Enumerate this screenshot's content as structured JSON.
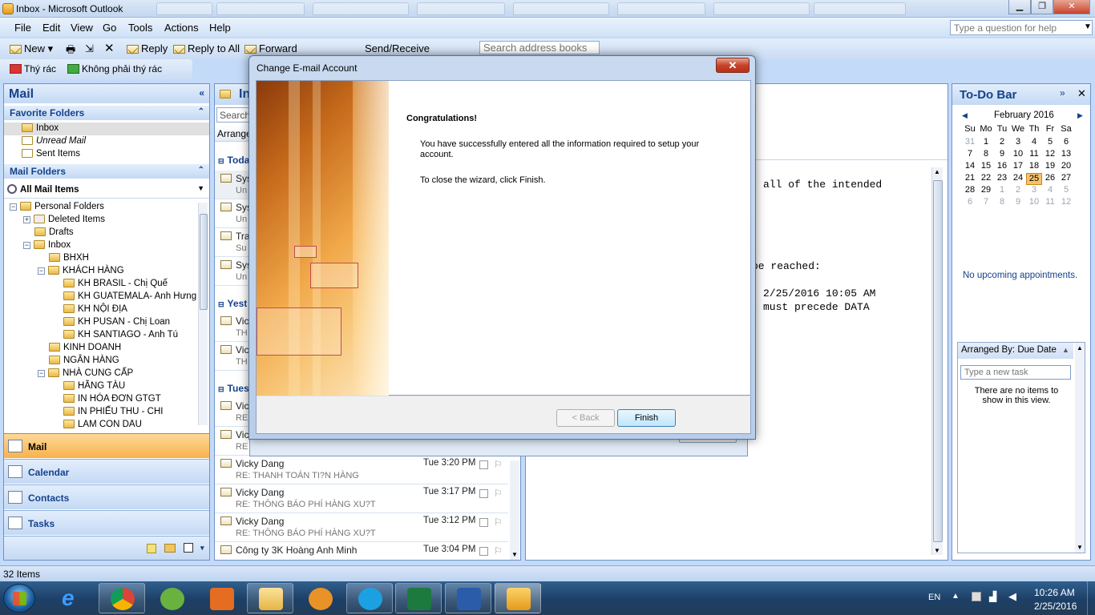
{
  "window": {
    "title": "Inbox - Microsoft Outlook",
    "min": "▁",
    "max": "❐",
    "close": "✕"
  },
  "menu": {
    "items": [
      "File",
      "Edit",
      "View",
      "Go",
      "Tools",
      "Actions",
      "Help"
    ],
    "help_placeholder": "Type a question for help"
  },
  "toolbar": {
    "new": "New",
    "reply": "Reply",
    "reply_all": "Reply to All",
    "forward": "Forward",
    "send_receive": "Send/Receive",
    "search_address": "Search address books",
    "junk": "Thý rác",
    "not_junk": "Không phải thý rác"
  },
  "nav": {
    "title": "Mail",
    "favorites_header": "Favorite Folders",
    "favorites": [
      "Inbox",
      "Unread Mail",
      "Sent Items"
    ],
    "mail_folders_header": "Mail Folders",
    "all_mail_items": "All Mail Items",
    "tree": {
      "personal": "Personal Folders",
      "deleted": "Deleted Items",
      "drafts": "Drafts",
      "inbox": "Inbox",
      "bhxh": "BHXH",
      "khach_hang": "KHÁCH HÀNG",
      "kh1": "KH BRASIL - Chị Quế",
      "kh2": "KH GUATEMALA- Anh Hưng",
      "kh3": "KH NỘI ĐỊA",
      "kh4": "KH PUSAN - Chị Loan",
      "kh5": "KH SANTIAGO - Anh Tú",
      "kinh_doanh": "KINH DOANH",
      "ngan_hang": "NGÂN HÀNG",
      "nha_cung_cap": "NHÀ CUNG CẤP",
      "ncc1": "HÃNG TÀU",
      "ncc2": "IN HÓA ĐƠN GTGT",
      "ncc3": "IN PHIẾU THU - CHI",
      "ncc4": "LÀM CON DẤU"
    },
    "buttons": [
      "Mail",
      "Calendar",
      "Contacts",
      "Tasks"
    ]
  },
  "list": {
    "header_title": "In",
    "search_placeholder": "Search",
    "arrange": "Arrange",
    "groups": [
      "Toda",
      "Yest",
      "Tues"
    ],
    "partial_rows": [
      {
        "from": "Sys",
        "subj": "Un"
      },
      {
        "from": "Sys",
        "subj": "Un"
      },
      {
        "from": "Tra",
        "subj": "Su"
      },
      {
        "from": "Sys",
        "subj": "Un"
      },
      {
        "from": "Vic",
        "subj": "TH"
      },
      {
        "from": "Vic",
        "subj": "TH"
      },
      {
        "from": "Vic",
        "subj": "RE"
      },
      {
        "from": "Vick",
        "subj": "RE"
      }
    ],
    "rows": [
      {
        "from": "Vicky Dang",
        "subj": "RE: THANH TOÁN TI?N HÀNG",
        "time": "Tue 3:20 PM"
      },
      {
        "from": "Vicky Dang",
        "subj": "RE: THÔNG BÁO PHÍ HÀNG XU?T",
        "time": "Tue 3:17 PM"
      },
      {
        "from": "Vicky Dang",
        "subj": "RE: THÔNG BÁO PHÍ HÀNG XU?T",
        "time": "Tue 3:12 PM"
      },
      {
        "from": "Công ty 3K Hoàng Anh Minh",
        "subj": "",
        "time": "Tue 3:04 PM"
      }
    ]
  },
  "reading": {
    "line1": "all of the intended",
    "line2": "be reached:",
    "line3": "2/25/2016 10:05 AM",
    "line4": "must precede DATA"
  },
  "todo": {
    "title": "To-Do Bar",
    "month": "February 2016",
    "days": [
      "Su",
      "Mo",
      "Tu",
      "We",
      "Th",
      "Fr",
      "Sa"
    ],
    "weeks": [
      [
        "31",
        "1",
        "2",
        "3",
        "4",
        "5",
        "6"
      ],
      [
        "7",
        "8",
        "9",
        "10",
        "11",
        "12",
        "13"
      ],
      [
        "14",
        "15",
        "16",
        "17",
        "18",
        "19",
        "20"
      ],
      [
        "21",
        "22",
        "23",
        "24",
        "25",
        "26",
        "27"
      ],
      [
        "28",
        "29",
        "1",
        "2",
        "3",
        "4",
        "5"
      ],
      [
        "6",
        "7",
        "8",
        "9",
        "10",
        "11",
        "12"
      ]
    ],
    "no_appointments": "No upcoming appointments.",
    "arranged_by": "Arranged By: Due Date",
    "new_task_placeholder": "Type a new task",
    "no_items": "There are no items to show in this view."
  },
  "status": {
    "items": "32 Items"
  },
  "dialog": {
    "title": "Change E-mail Account",
    "heading": "Congratulations!",
    "message": "You have successfully entered all the information required to setup your account.",
    "close_hint": "To close the wizard, click Finish.",
    "back": "< Back",
    "finish": "Finish"
  },
  "taskbar": {
    "lang": "EN",
    "time": "10:26 AM",
    "date": "2/25/2016"
  },
  "colors": {
    "accent": "#15428b",
    "selected_day": "#f8c26b"
  }
}
